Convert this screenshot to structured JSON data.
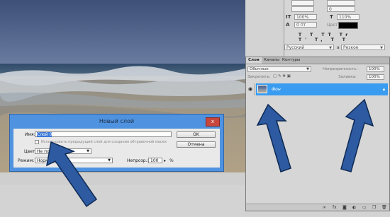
{
  "char_panel": {
    "size_a": "100%",
    "size_b": "110%",
    "tracking": "0",
    "leading_pt": "0 пт",
    "color_label": "Цвет:",
    "language": "Русский",
    "antialias": "Резкое",
    "aa_icon": "a",
    "format_buttons": [
      "T",
      "T",
      "TT",
      "Tr",
      "T'",
      "T,",
      "T",
      "T"
    ]
  },
  "layers": {
    "tabs": [
      "Слои",
      "Каналы",
      "Контуры"
    ],
    "blend_mode": "Обычные",
    "opacity_label": "Непрозрачность:",
    "opacity_value": "100%",
    "lock_label": "Закрепить:",
    "fill_label": "Заливка:",
    "fill_value": "100%",
    "layer_name": "Фон",
    "eye_icon": "eye-icon",
    "lock_icon": "lock-icon",
    "bottom_icons": [
      "link-icon",
      "fx-icon",
      "mask-icon",
      "adjustment-icon",
      "folder-icon",
      "new-layer-icon",
      "trash-icon"
    ]
  },
  "dialog": {
    "title": "Новый слой",
    "close_label": "x",
    "name_label": "Имя:",
    "name_value": "Слой 0",
    "clip_checkbox_label": "Использовать предыдущий слой для создания обтравочной маски",
    "color_label": "Цвет:",
    "color_value": "Не показывать",
    "mode_label": "Режим:",
    "mode_value": "Нормальный",
    "opacity_label": "Непрозр.:",
    "opacity_value": "100",
    "opacity_unit": "%",
    "ok_label": "OK",
    "cancel_label": "Отмена"
  },
  "colors": {
    "selection": "#3a9cf0",
    "dialog_frame": "#4f93e0",
    "annotation_arrow": "#2d5aa0"
  }
}
